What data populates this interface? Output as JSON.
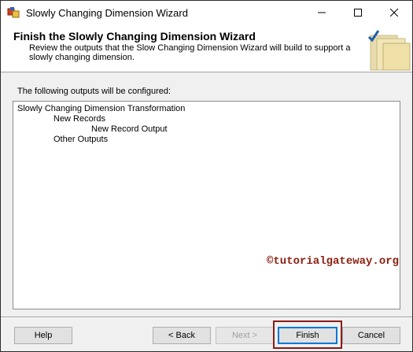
{
  "window": {
    "title": "Slowly Changing Dimension Wizard"
  },
  "header": {
    "title": "Finish the Slowly Changing Dimension Wizard",
    "description": "Review the outputs that the Slow Changing Dimension Wizard will build to support a slowly changing dimension."
  },
  "outputs": {
    "label": "The following outputs will be configured:",
    "tree": {
      "root": "Slowly Changing Dimension Transformation",
      "new_records": "New Records",
      "new_record_output": "New Record Output",
      "other_outputs": "Other Outputs"
    }
  },
  "watermark": "©tutorialgateway.org",
  "buttons": {
    "help": "Help",
    "back": "< Back",
    "next": "Next >",
    "finish": "Finish",
    "cancel": "Cancel"
  },
  "icons": {
    "app": "wizard-app-icon",
    "minimize": "minimize-icon",
    "maximize": "maximize-icon",
    "close": "close-icon",
    "header_art": "wizard-checkmark-art"
  },
  "colors": {
    "highlight_border": "#8b1a1a",
    "watermark": "#8a2010",
    "default_button_border": "#0078d7"
  }
}
